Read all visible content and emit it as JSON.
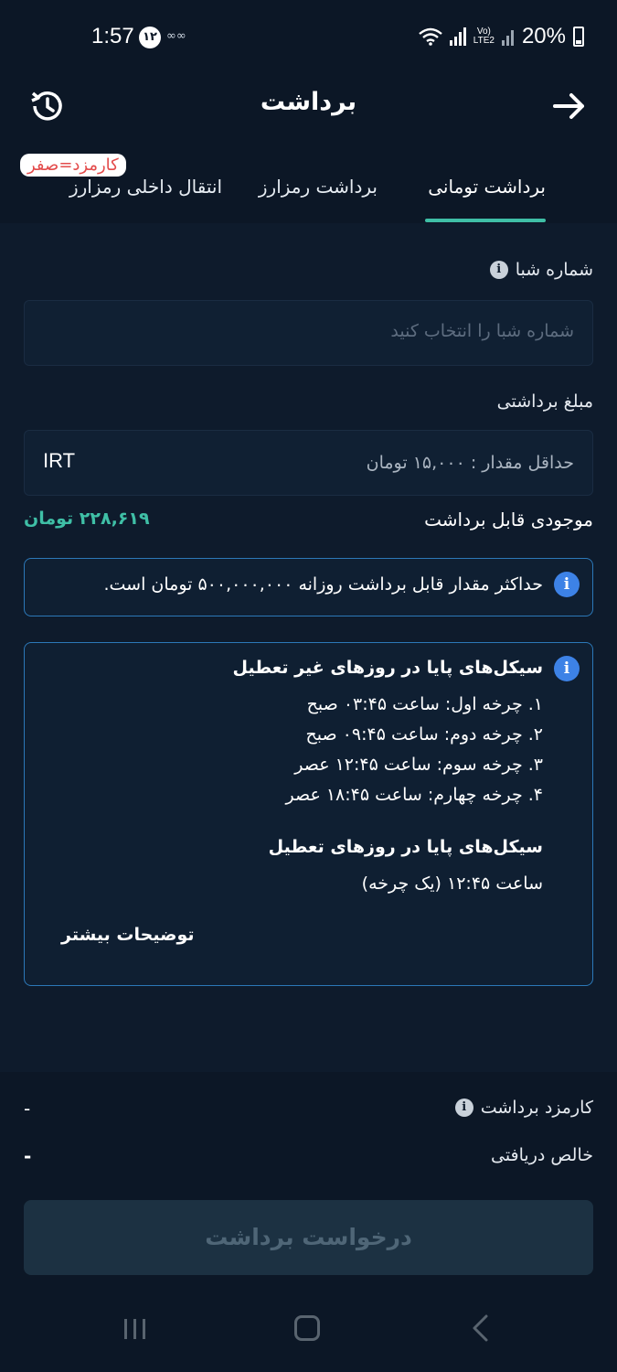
{
  "status_bar": {
    "time": "1:57",
    "notif_badge": "۱۲",
    "dots": "∞∞",
    "lte": "Vo)\nLTE2",
    "battery": "20%"
  },
  "header": {
    "title": "برداشت"
  },
  "tabs": [
    {
      "label": "برداشت تومانی",
      "active": true
    },
    {
      "label": "برداشت رمزارز",
      "active": false
    },
    {
      "label": "انتقال داخلی رمزارز",
      "active": false
    }
  ],
  "fee_badge": "کارمزد=صفر",
  "sheba": {
    "label": "شماره شبا",
    "placeholder": "شماره شبا را انتخاب کنید"
  },
  "amount": {
    "label": "مبلغ برداشتی",
    "hint": "حداقل مقدار : ۱۵,۰۰۰ تومان",
    "unit": "IRT"
  },
  "balance": {
    "label": "موجودی قابل برداشت",
    "value": "۲۲۸,۶۱۹ تومان"
  },
  "notice": {
    "text": "حداکثر مقدار قابل برداشت روزانه ۵۰۰,۰۰۰,۰۰۰ تومان است."
  },
  "cycles": {
    "workdays_title": "سیکل‌های پایا در روزهای غیر تعطیل",
    "workdays": [
      "۱. چرخه اول: ساعت ۰۳:۴۵ صبح",
      "۲. چرخه دوم: ساعت ۰۹:۴۵ صبح",
      "۳. چرخه سوم: ساعت ۱۲:۴۵ عصر",
      "۴. چرخه چهارم: ساعت ۱۸:۴۵ عصر"
    ],
    "holidays_title": "سیکل‌های پایا در روزهای تعطیل",
    "holidays_line": "ساعت ۱۲:۴۵ (یک چرخه)",
    "more": "توضیحات بیشتر"
  },
  "summary": {
    "fee_label": "کارمزد برداشت",
    "fee_value": "-",
    "net_label": "خالص دریافتی",
    "net_value": "-"
  },
  "submit_label": "درخواست برداشت",
  "colors": {
    "background": "#0e1b2c",
    "accent": "#3fbfa6",
    "info_blue": "#3d82e6",
    "fee_red": "#e34b4b"
  }
}
